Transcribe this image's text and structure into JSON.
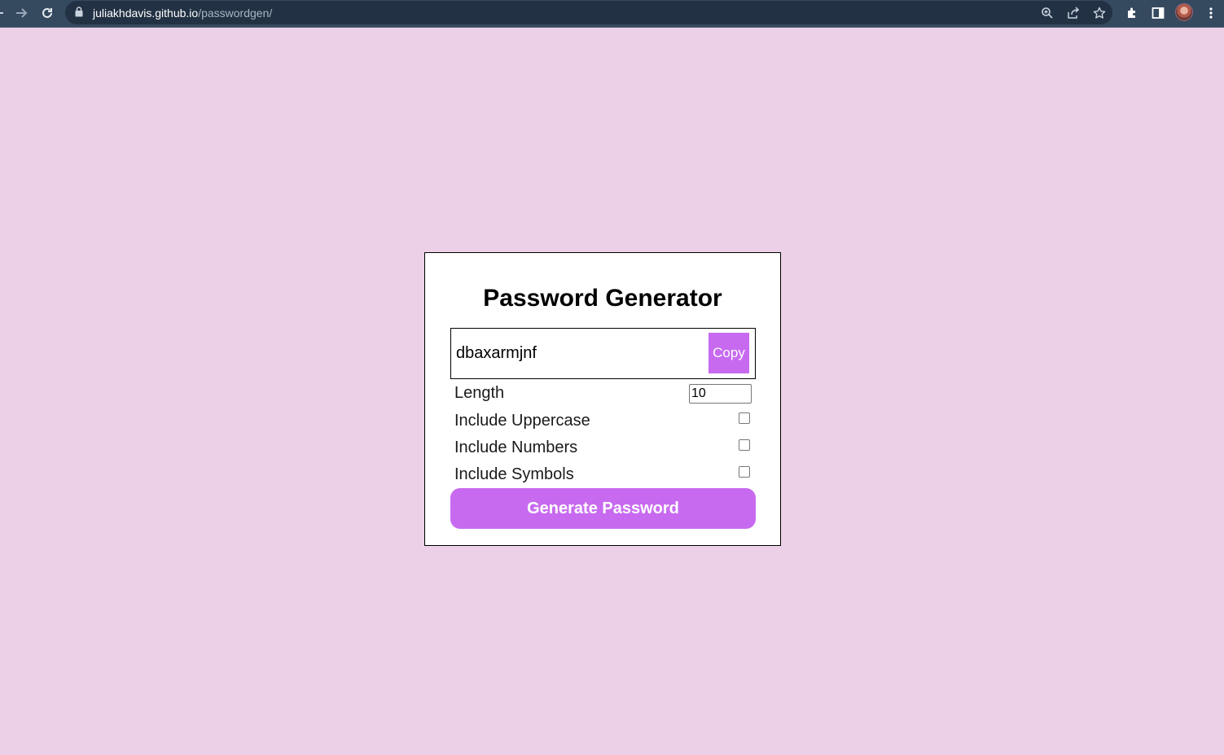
{
  "browser": {
    "url_host": "juliakhdavis.github.io",
    "url_path": "/passwordgen/"
  },
  "app": {
    "title": "Password Generator",
    "password": "dbaxarmjnf",
    "copy_label": "Copy",
    "length_label": "Length",
    "length_value": "10",
    "options": [
      {
        "label": "Include Uppercase",
        "checked": false
      },
      {
        "label": "Include Numbers",
        "checked": false
      },
      {
        "label": "Include Symbols",
        "checked": false
      }
    ],
    "generate_label": "Generate Password"
  },
  "colors": {
    "page_bg": "#ebd0e7",
    "accent": "#c86af0",
    "chrome_bg": "#35495f"
  }
}
